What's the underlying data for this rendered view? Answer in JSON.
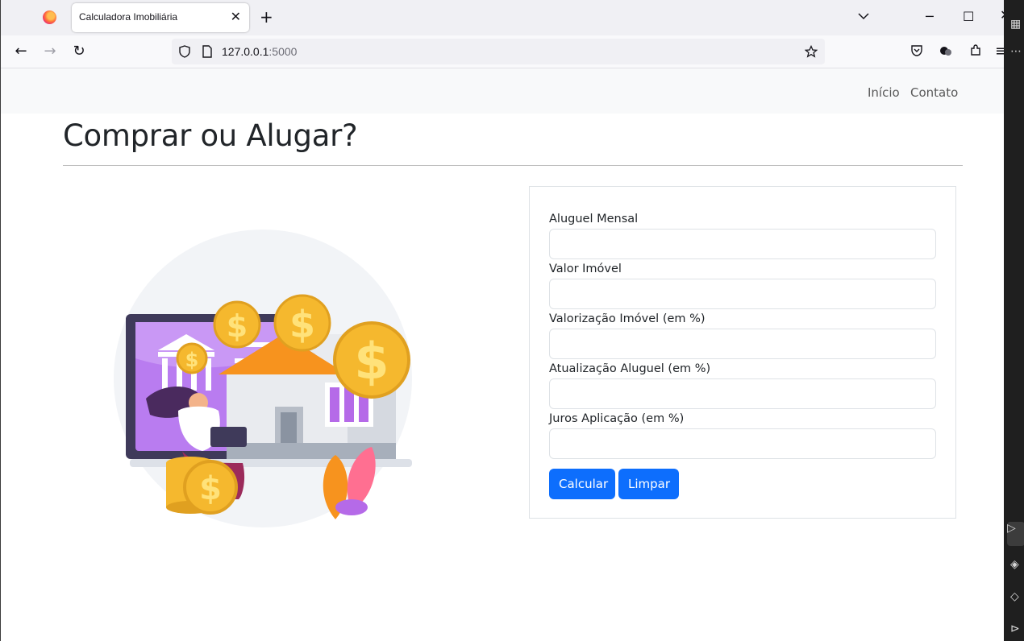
{
  "browser": {
    "tab_title": "Calculadora Imobiliária",
    "url_host": "127.0.0.1",
    "url_port": ":5000"
  },
  "site_nav": {
    "items": [
      "Início",
      "Contato"
    ]
  },
  "page": {
    "title": "Comprar ou Alugar?"
  },
  "form": {
    "fields": [
      {
        "label": "Aluguel Mensal",
        "value": ""
      },
      {
        "label": "Valor Imóvel",
        "value": ""
      },
      {
        "label": "Valorização Imóvel (em %)",
        "value": ""
      },
      {
        "label": "Atualização Aluguel (em %)",
        "value": ""
      },
      {
        "label": "Juros Aplicação (em %)",
        "value": ""
      }
    ],
    "calc_label": "Calcular",
    "clear_label": "Limpar"
  },
  "colors": {
    "primary": "#0d6efd",
    "nav_bg": "#f8f9fa",
    "coin": "#f5b82e",
    "screen_purple": "#a56cf0",
    "roof_orange": "#f7931e"
  }
}
